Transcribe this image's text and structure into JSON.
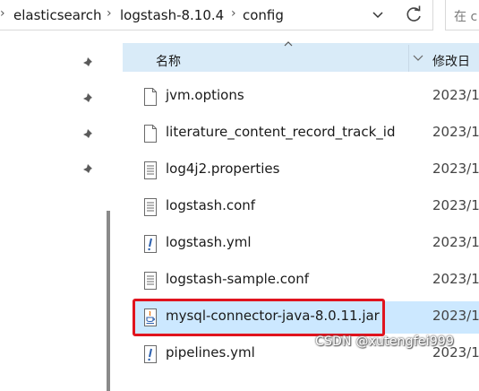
{
  "breadcrumb": [
    "elasticsearch",
    "logstash-8.10.4",
    "config"
  ],
  "search": {
    "placeholder_text": "在 c"
  },
  "columns": {
    "name": "名称",
    "date_modified": "修改日"
  },
  "files": [
    {
      "name": "jvm.options",
      "date": "2023/1",
      "icon": "blank-file-icon",
      "selected": false
    },
    {
      "name": "literature_content_record_track_id",
      "date": "2023/1",
      "icon": "blank-file-icon",
      "selected": false
    },
    {
      "name": "log4j2.properties",
      "date": "2023/1",
      "icon": "text-file-icon",
      "selected": false
    },
    {
      "name": "logstash.conf",
      "date": "2023/1",
      "icon": "text-file-icon",
      "selected": false
    },
    {
      "name": "logstash.yml",
      "date": "2023/1",
      "icon": "yml-file-icon",
      "selected": false
    },
    {
      "name": "logstash-sample.conf",
      "date": "2023/1",
      "icon": "text-file-icon",
      "selected": false
    },
    {
      "name": "mysql-connector-java-8.0.11.jar",
      "date": "2023/1",
      "icon": "java-jar-icon",
      "selected": true
    },
    {
      "name": "pipelines.yml",
      "date": "2023/1",
      "icon": "yml-file-icon",
      "selected": false
    }
  ],
  "watermark": "CSDN @xutengfei999",
  "colors": {
    "selection": "#cce8ff",
    "header": "#d9ebf8",
    "highlight_border": "#e0141e"
  }
}
